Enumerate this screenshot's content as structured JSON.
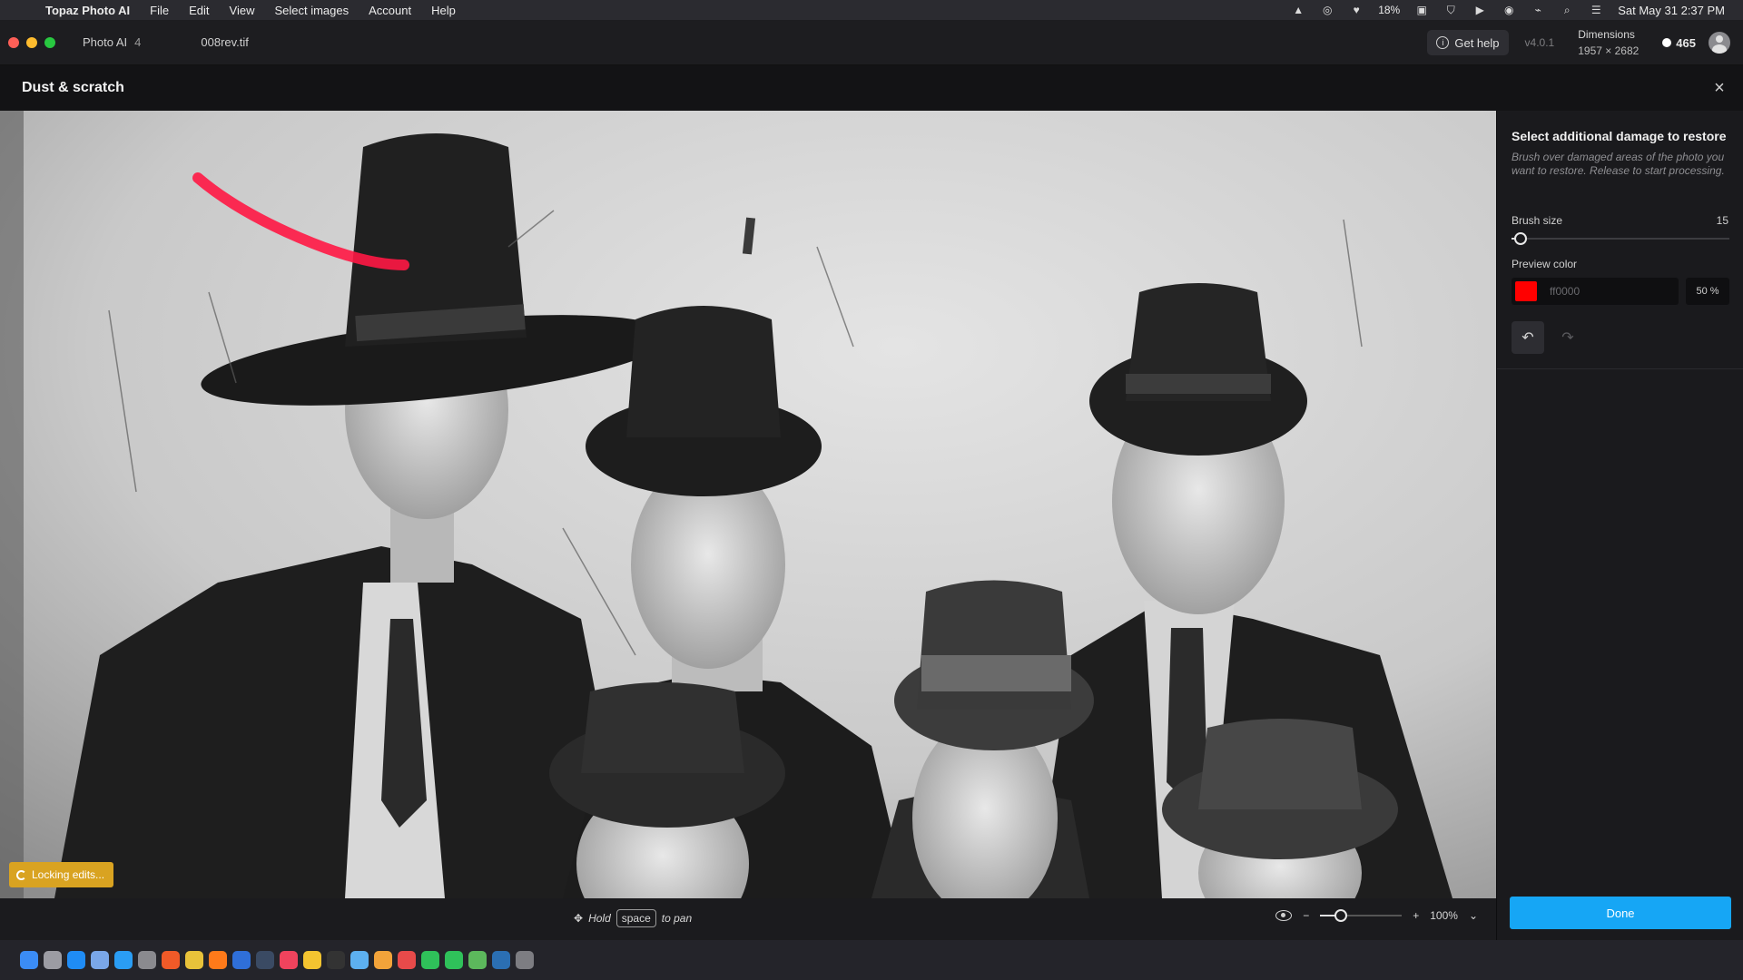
{
  "menubar": {
    "app_name": "Topaz Photo AI",
    "menus": [
      "File",
      "Edit",
      "View",
      "Select images",
      "Account",
      "Help"
    ],
    "battery": "18%",
    "datetime": "Sat May 31  2:37 PM"
  },
  "titlebar": {
    "app_label": "Photo AI",
    "app_version_num": "4",
    "file_name": "008rev.tif",
    "help_label": "Get help",
    "version": "v4.0.1",
    "dimensions_label": "Dimensions",
    "dimensions_value": "1957 × 2682",
    "credits": "465"
  },
  "panel": {
    "title": "Dust & scratch",
    "close_icon": "×"
  },
  "canvas": {
    "locking_label": "Locking edits..."
  },
  "bottombar": {
    "hint_hold": "Hold",
    "hint_key": "space",
    "hint_pan": "to pan",
    "zoom_value": "100%",
    "zoom_level": 0.25
  },
  "sidepanel": {
    "title": "Select additional damage to restore",
    "description": "Brush over damaged areas of the photo you want to restore. Release to start processing.",
    "brush_label": "Brush size",
    "brush_value": "15",
    "brush_level": 0.04,
    "color_label": "Preview color",
    "color_hex": "ff0000",
    "color_swatch": "#ff0000",
    "opacity": "50 %",
    "done_label": "Done"
  },
  "colors": {
    "accent": "#16a6f5",
    "locking": "#d9a321",
    "brush_stroke": "#ff1744"
  },
  "dock_icons": [
    "finder-icon",
    "launchpad-icon",
    "app-store-icon",
    "mail-icon",
    "safari-icon",
    "system-settings-icon",
    "brave-icon",
    "chrome-icon",
    "firefox-icon",
    "photoshop-icon",
    "bridge-icon",
    "music-icon",
    "notes-icon",
    "terminal-icon",
    "preview-icon",
    "photos-icon",
    "calendar-icon",
    "messages-icon",
    "facetime-icon",
    "maps-icon",
    "topaz-icon",
    "trash-icon"
  ]
}
